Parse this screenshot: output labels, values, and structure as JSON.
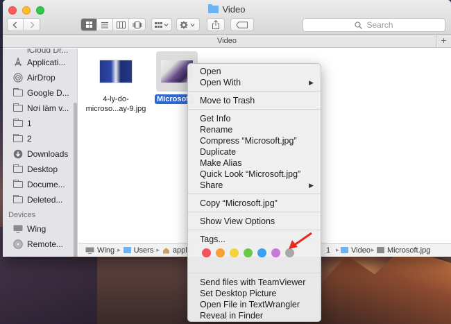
{
  "window": {
    "title": "Video",
    "path_header": "Video"
  },
  "toolbar": {
    "search_placeholder": "Search",
    "back_icon": "chevron-left-icon",
    "forward_icon": "chevron-right-icon"
  },
  "sidebar": {
    "partial_item": "iCloud Dr...",
    "items": [
      {
        "label": "Applicati...",
        "icon": "applications-icon"
      },
      {
        "label": "AirDrop",
        "icon": "airdrop-icon"
      },
      {
        "label": "Google D...",
        "icon": "folder-icon"
      },
      {
        "label": "Nơi làm v...",
        "icon": "folder-icon"
      },
      {
        "label": "1",
        "icon": "folder-icon"
      },
      {
        "label": "2",
        "icon": "folder-icon"
      },
      {
        "label": "Downloads",
        "icon": "downloads-icon"
      },
      {
        "label": "Desktop",
        "icon": "folder-icon"
      },
      {
        "label": "Docume...",
        "icon": "folder-icon"
      },
      {
        "label": "Deleted...",
        "icon": "folder-icon"
      }
    ],
    "devices_header": "Devices",
    "devices": [
      {
        "label": "Wing",
        "icon": "computer-icon"
      },
      {
        "label": "Remote...",
        "icon": "disc-icon"
      }
    ]
  },
  "files": [
    {
      "name_line1": "4-ly-do-",
      "name_line2": "microso...ay-9.jpg"
    },
    {
      "name": "Microsoft"
    }
  ],
  "statusbar": {
    "crumbs": [
      "Wing",
      "Users",
      "apple",
      "1",
      "Video",
      "Microsoft.jpg"
    ]
  },
  "context_menu": {
    "group1": [
      "Open",
      "Open With"
    ],
    "group2": [
      "Move to Trash"
    ],
    "group3": [
      "Get Info",
      "Rename",
      "Compress “Microsoft.jpg”",
      "Duplicate",
      "Make Alias",
      "Quick Look “Microsoft.jpg”",
      "Share"
    ],
    "group4": [
      "Copy “Microsoft.jpg”"
    ],
    "group5": [
      "Show View Options"
    ],
    "tags_label": "Tags...",
    "tag_colors": [
      "#f2545b",
      "#f7a035",
      "#f3d23d",
      "#68c84a",
      "#3aa0f2",
      "#c878d9",
      "#a8a8a8"
    ],
    "group7": [
      "Send files with TeamViewer",
      "Set Desktop Picture",
      "Open File in TextWrangler",
      "Reveal in Finder"
    ]
  }
}
